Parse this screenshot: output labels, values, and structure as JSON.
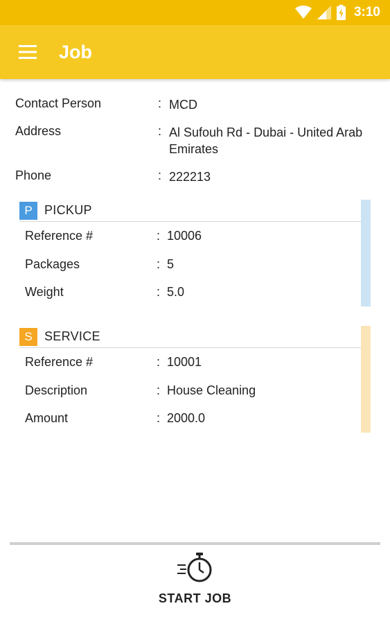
{
  "status_bar": {
    "time": "3:10"
  },
  "app_bar": {
    "title": "Job"
  },
  "contact": {
    "contact_person": {
      "label": "Contact Person",
      "value": "MCD"
    },
    "address": {
      "label": "Address",
      "value": "Al Sufouh Rd - Dubai - United Arab Emirates"
    },
    "phone": {
      "label": "Phone",
      "value": "222213"
    }
  },
  "pickup": {
    "badge": "P",
    "title": "PICKUP",
    "color": "#4a9be0",
    "stripe_color": "#cce3f4",
    "fields": [
      {
        "label": "Reference #",
        "value": "10006"
      },
      {
        "label": "Packages",
        "value": "5"
      },
      {
        "label": "Weight",
        "value": "5.0"
      }
    ]
  },
  "service": {
    "badge": "S",
    "title": "SERVICE",
    "color": "#f5a623",
    "stripe_color": "#fbe5b8",
    "fields": [
      {
        "label": "Reference #",
        "value": "10001"
      },
      {
        "label": "Description",
        "value": "House Cleaning"
      },
      {
        "label": "Amount",
        "value": "2000.0"
      }
    ]
  },
  "colon": ":",
  "footer": {
    "start_label": "START JOB",
    "icon": "stopwatch-icon"
  }
}
